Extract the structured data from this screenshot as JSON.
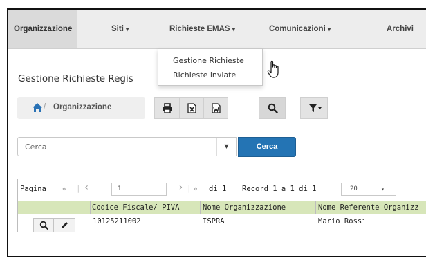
{
  "navbar": {
    "items": [
      {
        "label": "Organizzazione",
        "caret": ""
      },
      {
        "label": "Siti",
        "caret": "▾"
      },
      {
        "label": "Richieste EMAS",
        "caret": "▾"
      },
      {
        "label": "Comunicazioni",
        "caret": "▾"
      },
      {
        "label": "Archivi",
        "caret": ""
      }
    ]
  },
  "dropdown": {
    "items": [
      "Gestione Richieste",
      "Richieste inviate"
    ]
  },
  "page": {
    "title": "Gestione Richieste Regis"
  },
  "breadcrumb": {
    "separator": "/",
    "label": "Organizzazione"
  },
  "toolbar": {
    "icons": [
      "print-icon",
      "excel-icon",
      "word-icon",
      "search-icon",
      "filter-icon"
    ]
  },
  "search": {
    "placeholder": "Cerca",
    "button_label": "Cerca"
  },
  "pager": {
    "page_label": "Pagina",
    "first": "«",
    "prev": "‹",
    "page_value": "1",
    "next": "›",
    "last": "»",
    "of_label": "di 1",
    "records_label": "Record 1 a 1 di 1",
    "page_size": "20",
    "page_size_caret": "▾"
  },
  "table": {
    "columns": [
      "",
      "Codice Fiscale/ PIVA",
      "Nome Organizzazione",
      "Nome Referente Organizz"
    ],
    "rows": [
      {
        "codice_fiscale": "10125211002",
        "nome_organizzazione": "ISPRA",
        "nome_referente": "Mario Rossi"
      }
    ]
  }
}
